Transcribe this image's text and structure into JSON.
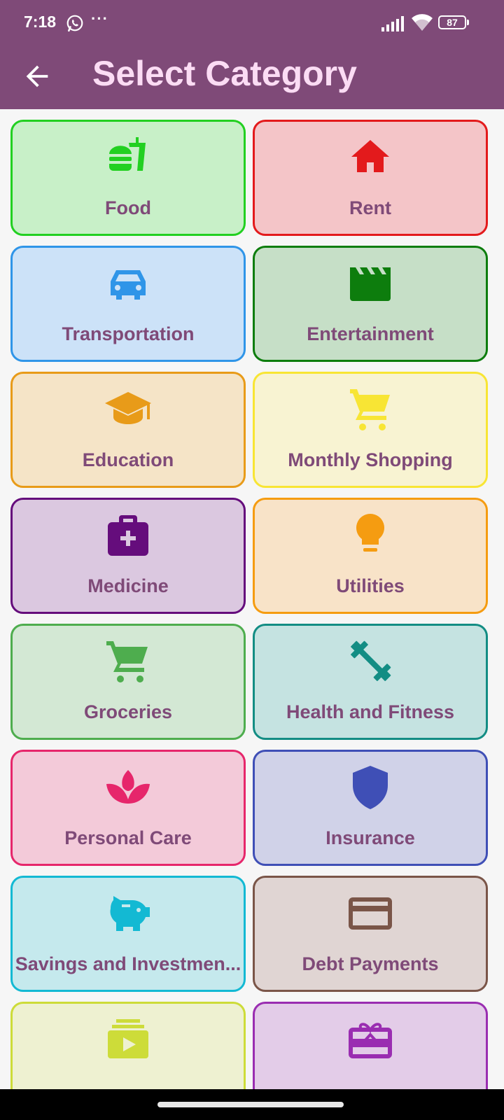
{
  "status_bar": {
    "time": "7:18",
    "battery": "87",
    "more": "···"
  },
  "header": {
    "title": "Select Category"
  },
  "categories": [
    {
      "label": "Food",
      "icon": "fastfood-icon",
      "bg": "#c8f0c8",
      "border": "#22d021",
      "icon_color": "#22d021"
    },
    {
      "label": "Rent",
      "icon": "home-icon",
      "bg": "#f4c5c8",
      "border": "#e31a1c",
      "icon_color": "#e31a1c"
    },
    {
      "label": "Transportation",
      "icon": "car-icon",
      "bg": "#cce2f8",
      "border": "#2f95e8",
      "icon_color": "#2f95e8"
    },
    {
      "label": "Entertainment",
      "icon": "clapperboard-icon",
      "bg": "#c6dfc7",
      "border": "#0d7d0d",
      "icon_color": "#0d7d0d"
    },
    {
      "label": "Education",
      "icon": "graduation-cap-icon",
      "bg": "#f5e4c7",
      "border": "#e89b19",
      "icon_color": "#e89b19"
    },
    {
      "label": "Monthly Shopping",
      "icon": "shopping-cart-icon",
      "bg": "#f8f3d2",
      "border": "#f8e534",
      "icon_color": "#f8e534"
    },
    {
      "label": "Medicine",
      "icon": "medical-kit-icon",
      "bg": "#dbc8e0",
      "border": "#650d7c",
      "icon_color": "#650d7c"
    },
    {
      "label": "Utilities",
      "icon": "lightbulb-icon",
      "bg": "#f8e3c8",
      "border": "#f59c11",
      "icon_color": "#f59c11"
    },
    {
      "label": "Groceries",
      "icon": "grocery-cart-icon",
      "bg": "#d3e8d4",
      "border": "#4ead4e",
      "icon_color": "#4ead4e"
    },
    {
      "label": "Health and Fitness",
      "icon": "dumbbell-icon",
      "bg": "#c5e3e1",
      "border": "#138d84",
      "icon_color": "#138d84"
    },
    {
      "label": "Personal Care",
      "icon": "lotus-icon",
      "bg": "#f3cad9",
      "border": "#e6266b",
      "icon_color": "#e6266b"
    },
    {
      "label": "Insurance",
      "icon": "shield-icon",
      "bg": "#d0d2e8",
      "border": "#3f4fb6",
      "icon_color": "#3f4fb6"
    },
    {
      "label": "Savings and Investmen...",
      "icon": "piggy-bank-icon",
      "bg": "#c5e9ed",
      "border": "#13b9d3",
      "icon_color": "#13b9d3"
    },
    {
      "label": "Debt Payments",
      "icon": "credit-card-icon",
      "bg": "#e0d5d3",
      "border": "#7a5548",
      "icon_color": "#7a5548"
    },
    {
      "label": "",
      "icon": "subscriptions-icon",
      "bg": "#eef1d1",
      "border": "#cddc39",
      "icon_color": "#cddc39"
    },
    {
      "label": "",
      "icon": "gift-card-icon",
      "bg": "#e3cce8",
      "border": "#9a2db1",
      "icon_color": "#9a2db1"
    }
  ]
}
